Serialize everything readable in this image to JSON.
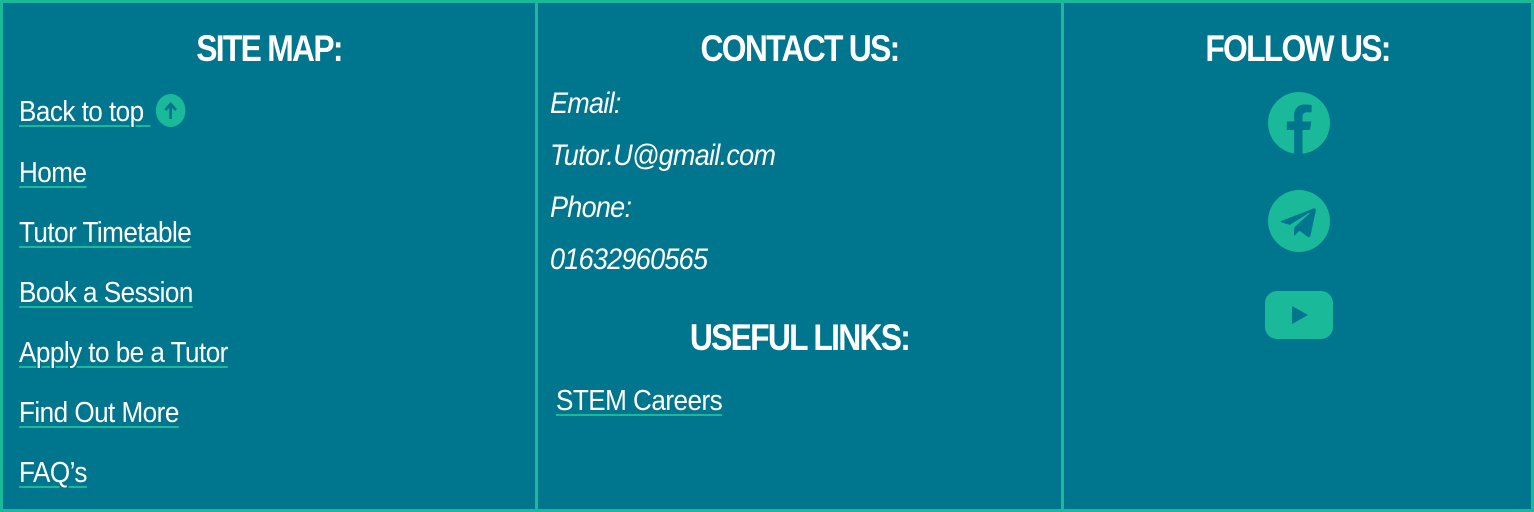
{
  "sitemap": {
    "heading": "SITE MAP:",
    "back_to_top": "Back to top ",
    "links": [
      "Home",
      "Tutor Timetable",
      "Book a Session",
      "Apply to be a Tutor",
      "Find Out More",
      "FAQ’s"
    ]
  },
  "contact": {
    "heading": "CONTACT US:",
    "email_label": "Email:",
    "email_value": "Tutor.U@gmail.com",
    "phone_label": "Phone:",
    "phone_value": "01632960565"
  },
  "useful": {
    "heading": "USEFUL LINKS:",
    "links": [
      "STEM Careers"
    ]
  },
  "follow": {
    "heading": "FOLLOW US:",
    "icons": [
      "facebook-icon",
      "telegram-icon",
      "youtube-icon"
    ]
  },
  "colors": {
    "background": "#00758e",
    "accent": "#19b99a",
    "text": "#ffffff"
  }
}
